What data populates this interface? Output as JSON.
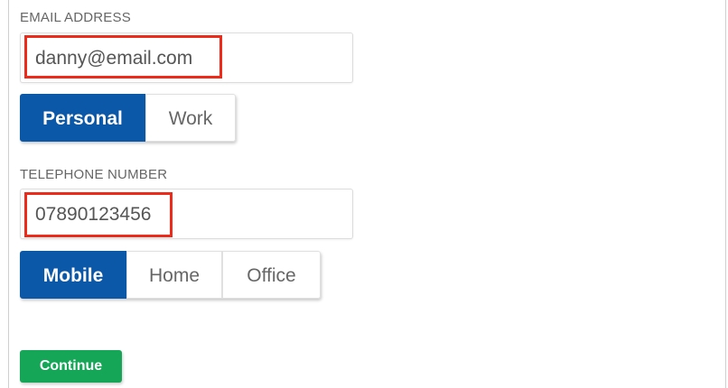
{
  "email": {
    "label": "EMAIL ADDRESS",
    "value": "danny@email.com",
    "types": [
      {
        "label": "Personal",
        "selected": true
      },
      {
        "label": "Work",
        "selected": false
      }
    ]
  },
  "telephone": {
    "label": "TELEPHONE NUMBER",
    "value": "07890123456",
    "types": [
      {
        "label": "Mobile",
        "selected": true
      },
      {
        "label": "Home",
        "selected": false
      },
      {
        "label": "Office",
        "selected": false
      }
    ]
  },
  "continue_label": "Continue",
  "colors": {
    "selected": "#0b57a8",
    "continue": "#15a658",
    "highlight": "#ee2a1b"
  }
}
